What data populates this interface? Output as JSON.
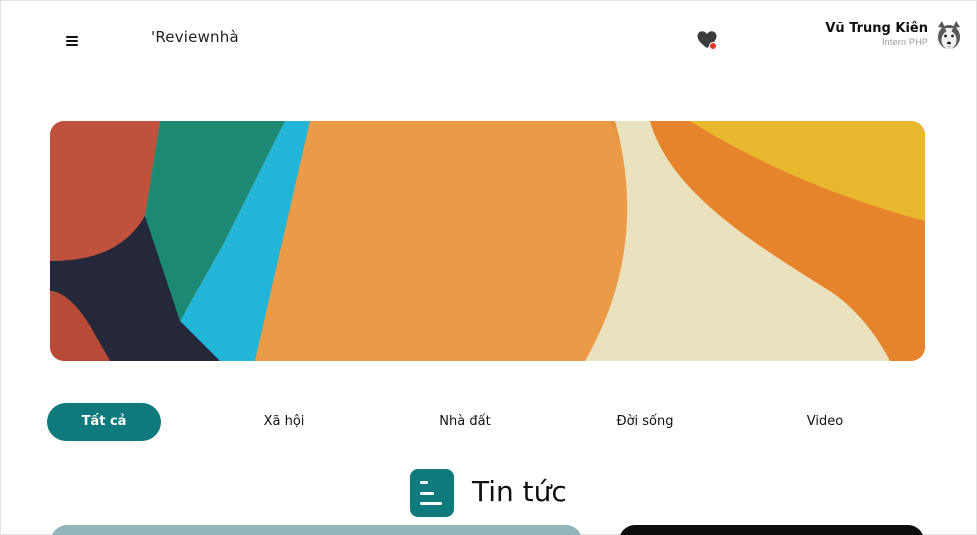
{
  "header": {
    "logo_text": "'Reviewnhà",
    "user": {
      "name": "Vũ Trung Kiên",
      "role": "Intern PHP"
    }
  },
  "icons": {
    "menu": "hamburger-menu-icon",
    "favorites": "heart-icon",
    "notification": "notification-dot-icon",
    "avatar": "husky-dog-avatar"
  },
  "tabs": [
    {
      "label": "Tất cả",
      "active": true
    },
    {
      "label": "Xã hội",
      "active": false
    },
    {
      "label": "Nhà đất",
      "active": false
    },
    {
      "label": "Đời sống",
      "active": false
    },
    {
      "label": "Video",
      "active": false
    }
  ],
  "section": {
    "title": "Tin tức"
  },
  "colors": {
    "accent": "#0e7a7d",
    "notification": "#e0312b"
  }
}
